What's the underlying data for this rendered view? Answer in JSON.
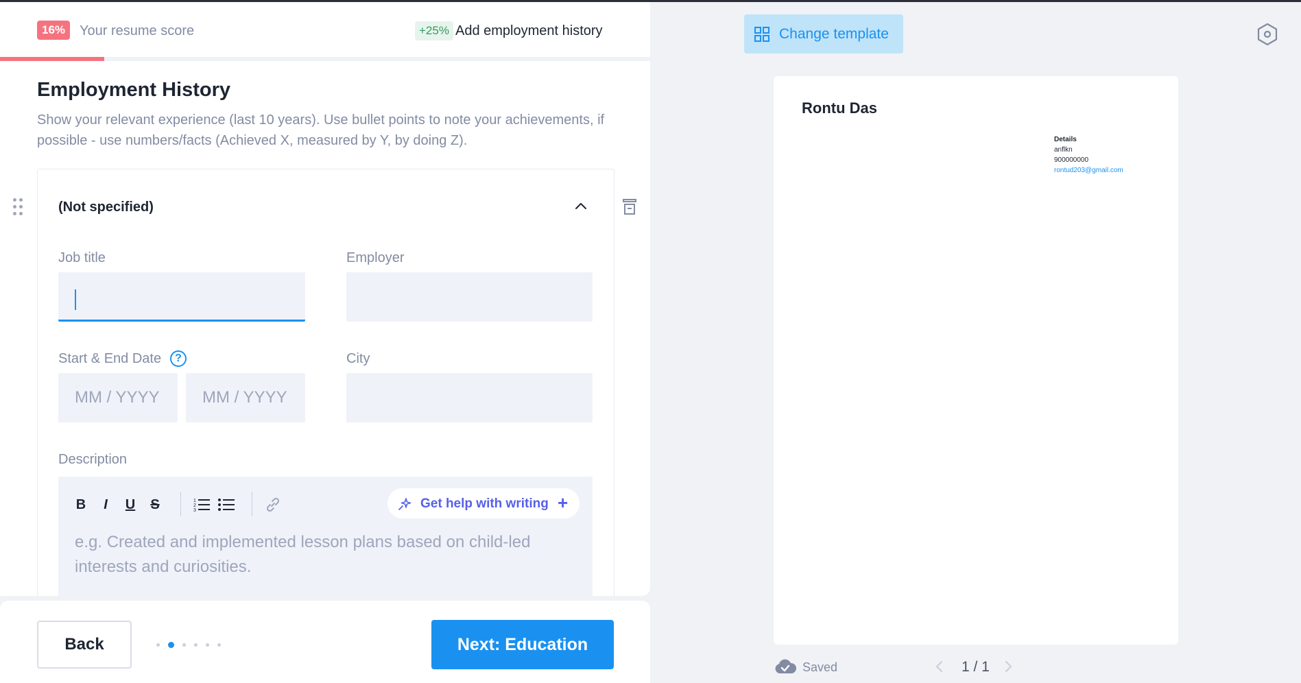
{
  "score": {
    "badge": "16%",
    "label": "Your resume score",
    "progress_fraction": 0.16
  },
  "tip": {
    "badge": "+25%",
    "label": "Add employment history"
  },
  "section": {
    "title": "Employment History",
    "description": "Show your relevant experience (last 10 years). Use bullet points to note your achievements, if possible - use numbers/facts (Achieved X, measured by Y, by doing Z)."
  },
  "entry": {
    "title": "(Not specified)",
    "job_title": {
      "label": "Job title",
      "value": ""
    },
    "employer": {
      "label": "Employer",
      "value": ""
    },
    "dates": {
      "label": "Start & End Date",
      "help": "?",
      "start_placeholder": "MM / YYYY",
      "end_placeholder": "MM / YYYY"
    },
    "city": {
      "label": "City",
      "value": ""
    },
    "description": {
      "label": "Description",
      "toolbar": {
        "bold": "B",
        "italic": "I",
        "underline": "U",
        "strike": "S"
      },
      "ai_help": "Get help with writing",
      "ai_plus": "+",
      "placeholder": "e.g. Created and implemented lesson plans based on child-led interests and curiosities."
    }
  },
  "footer": {
    "back": "Back",
    "next": "Next: Education",
    "steps_total": 6,
    "current_step": 2
  },
  "right": {
    "change_template": "Change template",
    "resume": {
      "name": "Rontu Das",
      "details_title": "Details",
      "details_line1": "anflkn",
      "details_phone": "900000000",
      "details_email": "rontud203@gmail.com"
    },
    "status": "Saved",
    "pagination": "1 / 1"
  },
  "colors": {
    "accent": "#1a91f0",
    "score": "#f5737f",
    "tip_bg": "#e7f4ed",
    "ai": "#5660e8"
  },
  "icons": [
    "drag-handle-icon",
    "chevron-up-icon",
    "trash-icon",
    "help-icon",
    "sparkle-icon",
    "link-icon",
    "ordered-list-icon",
    "bulleted-list-icon",
    "grid-icon",
    "settings-icon",
    "cloud-check-icon",
    "chevron-left-icon",
    "chevron-right-icon"
  ]
}
